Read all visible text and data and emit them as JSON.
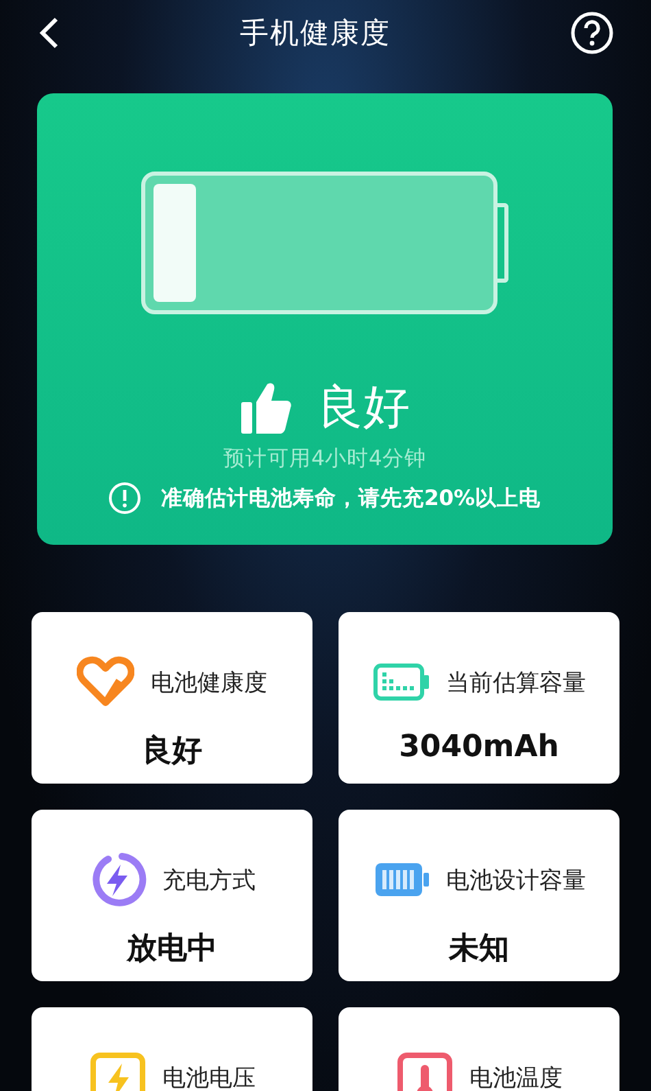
{
  "header": {
    "title": "手机健康度"
  },
  "summary": {
    "level": 0.13,
    "status": "良好",
    "estimate": "预计可用4小时4分钟",
    "notice": "准确估计电池寿命，请先充20%以上电"
  },
  "tiles": [
    {
      "kind": "heart",
      "label": "电池健康度",
      "value": "良好"
    },
    {
      "kind": "capacity",
      "label": "当前估算容量",
      "value": "3040mAh"
    },
    {
      "kind": "charge",
      "label": "充电方式",
      "value": "放电中"
    },
    {
      "kind": "battery",
      "label": "电池设计容量",
      "value": "未知"
    },
    {
      "kind": "voltage",
      "label": "电池电压"
    },
    {
      "kind": "temperature",
      "label": "电池温度"
    }
  ]
}
